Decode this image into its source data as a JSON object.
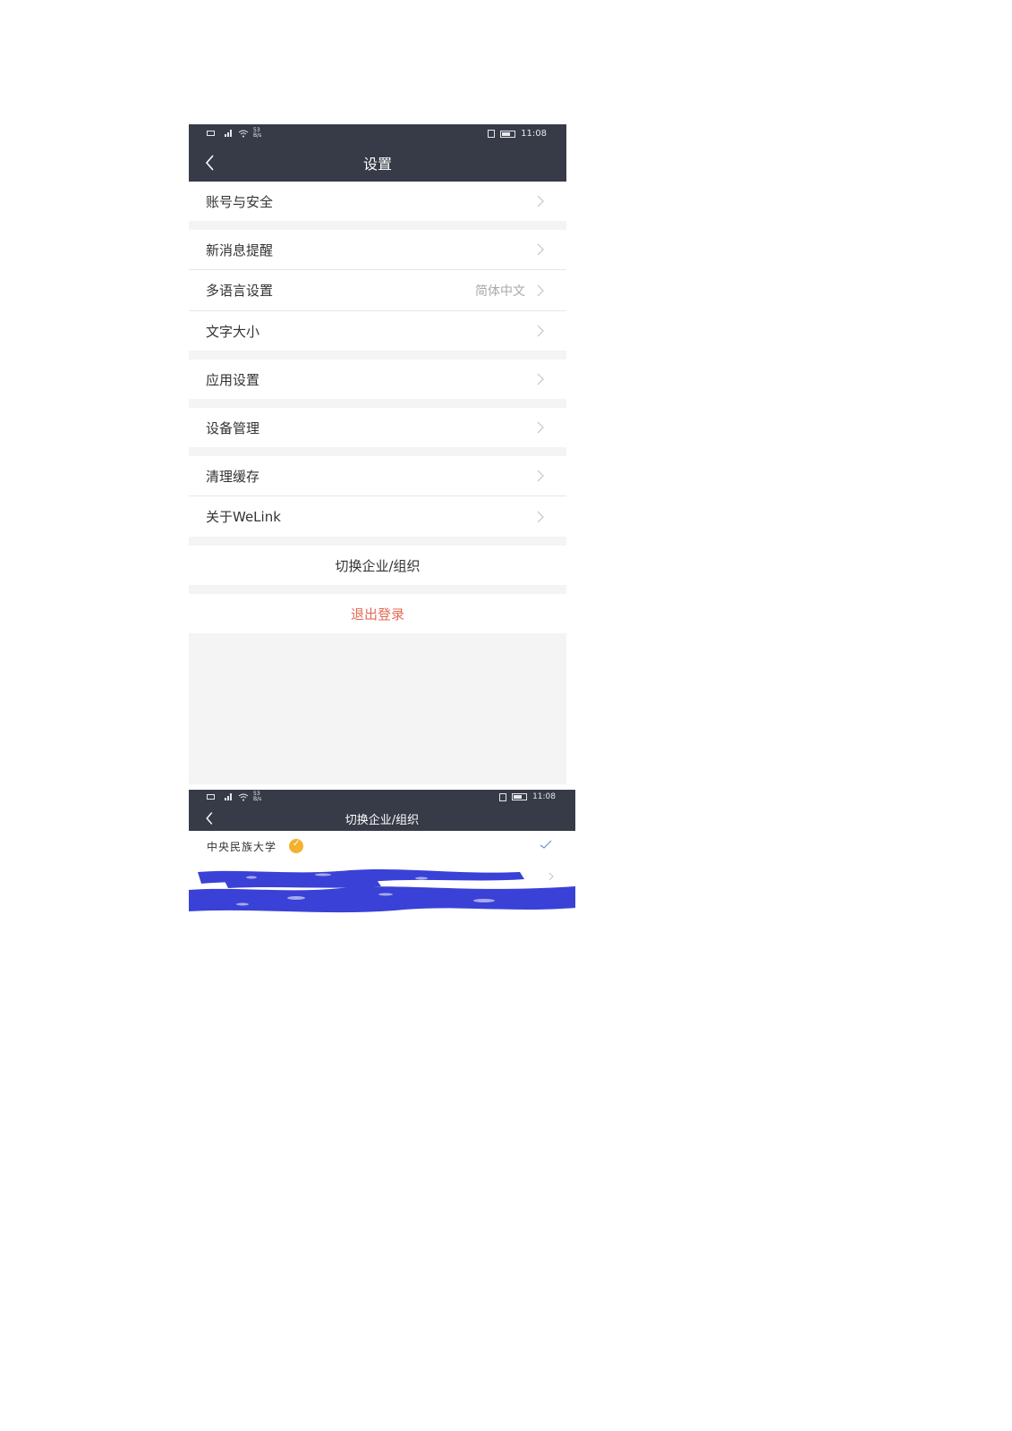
{
  "screen1": {
    "status": {
      "net_speed": "53\nB/s",
      "time": "11:08"
    },
    "title": "设置",
    "items": [
      {
        "label": "账号与安全"
      },
      {
        "label": "新消息提醒"
      },
      {
        "label": "多语言设置",
        "value": "简体中文"
      },
      {
        "label": "文字大小"
      },
      {
        "label": "应用设置"
      },
      {
        "label": "设备管理"
      },
      {
        "label": "清理缓存"
      },
      {
        "label": "关于WeLink"
      }
    ],
    "switch_org": "切换企业/组织",
    "logout": "退出登录"
  },
  "screen2": {
    "status": {
      "net_speed": "53\nB/s",
      "time": "11:08"
    },
    "title": "切换企业/组织",
    "orgs": [
      {
        "name": "中央民族大学",
        "selected": true
      }
    ]
  },
  "colors": {
    "bar": "#373b48",
    "logout": "#e46a55",
    "badge": "#f2b22e",
    "redaction": "#3a41d6"
  }
}
